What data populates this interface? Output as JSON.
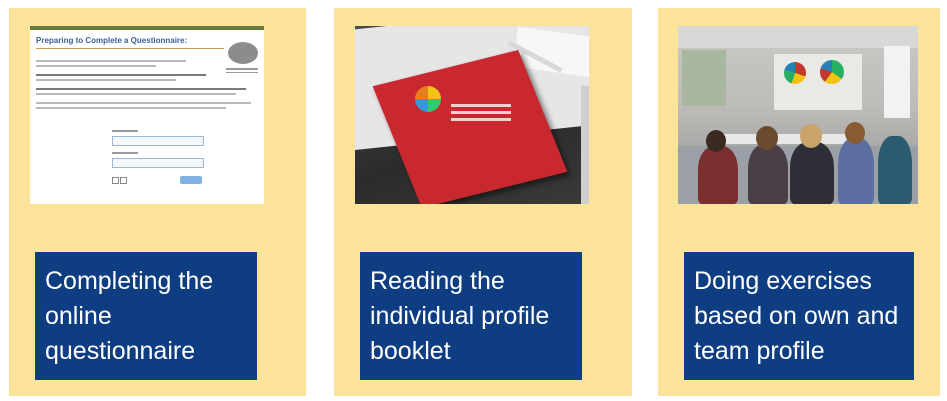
{
  "panels": [
    {
      "caption_lines": [
        "Completing the",
        "online",
        "questionnaire"
      ],
      "screenshot_title": "Preparing to Complete a Questionnaire:"
    },
    {
      "caption_lines": [
        "Reading the",
        "individual profile",
        "booklet"
      ]
    },
    {
      "caption_lines": [
        "Doing exercises",
        "based on own and",
        "team profile"
      ]
    }
  ],
  "colors": {
    "panel_bg": "#fbe39a",
    "caption_bg": "#0e3d82",
    "caption_text": "#ffffff"
  }
}
